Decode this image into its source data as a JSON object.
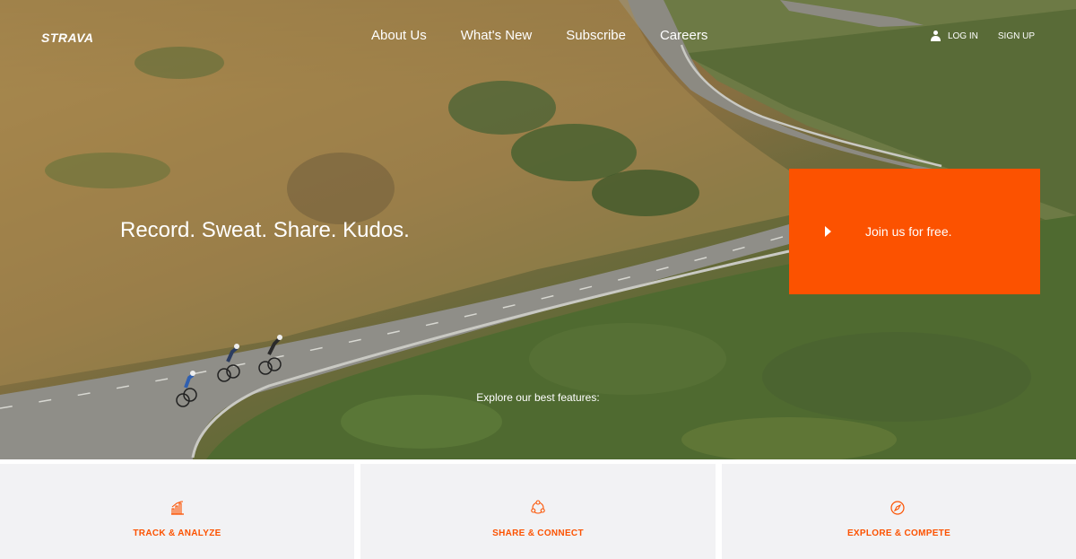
{
  "brand": {
    "logo_text": "STRAVA",
    "accent_color": "#fc5200"
  },
  "nav": {
    "links": [
      {
        "label": "About Us"
      },
      {
        "label": "What's New"
      },
      {
        "label": "Subscribe"
      },
      {
        "label": "Careers"
      }
    ],
    "login_icon": "user-icon",
    "login_label": "LOG IN",
    "signup_label": "SIGN UP"
  },
  "hero": {
    "tagline": "Record. Sweat. Share. Kudos.",
    "cta_icon": "play-arrow-icon",
    "cta_label": "Join us for free.",
    "explore_text": "Explore our best features:"
  },
  "features": [
    {
      "icon": "bar-chart-icon",
      "label": "TRACK & ANALYZE"
    },
    {
      "icon": "connect-icon",
      "label": "SHARE & CONNECT"
    },
    {
      "icon": "compass-icon",
      "label": "EXPLORE & COMPETE"
    }
  ]
}
